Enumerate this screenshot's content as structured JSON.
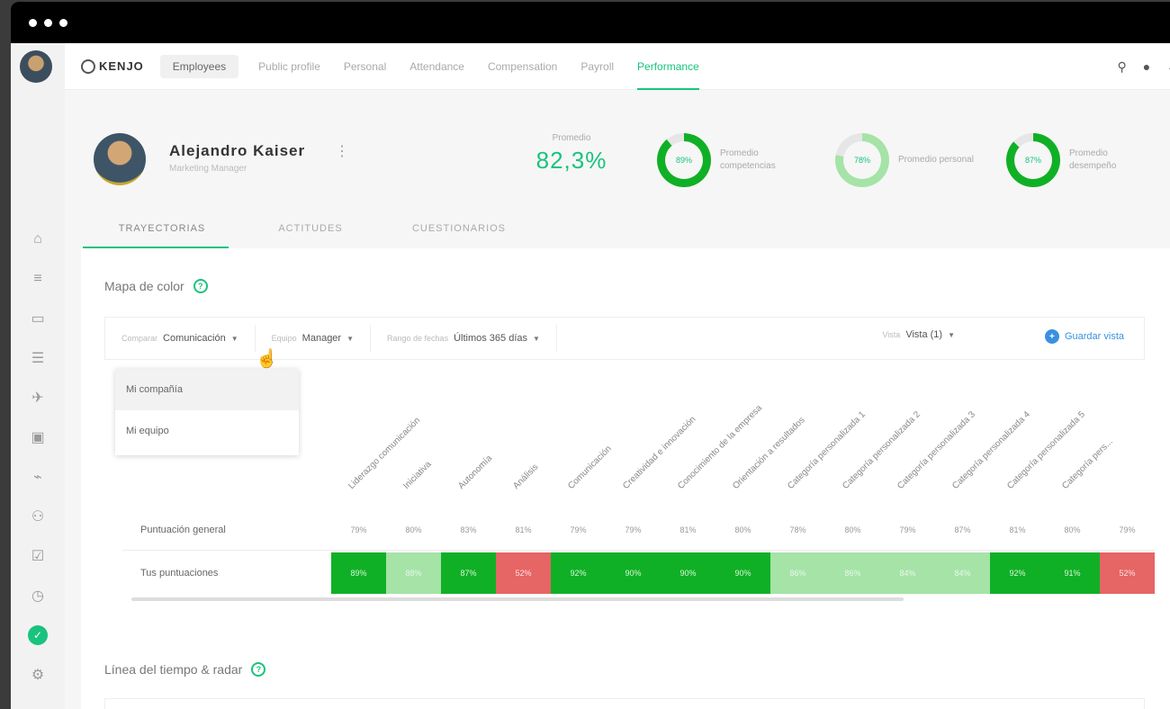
{
  "window": {
    "title_dots": 3
  },
  "topnav": {
    "logo": "KENJO",
    "pill": "Employees",
    "tabs": [
      "Public profile",
      "Personal",
      "Attendance",
      "Compensation",
      "Payroll",
      "Performance"
    ],
    "active_tab": "Performance"
  },
  "profile": {
    "name": "Alejandro Kaiser",
    "role": "Marketing Manager",
    "average_label": "Promedio",
    "average_value": "82,3%",
    "rings": [
      {
        "value": "89%",
        "fraction": 0.89,
        "label": "Promedio competencias",
        "style": "dark"
      },
      {
        "value": "78%",
        "fraction": 0.78,
        "label": "Promedio personal",
        "style": "light"
      },
      {
        "value": "87%",
        "fraction": 0.87,
        "label": "Promedio desempeño",
        "style": "dark"
      }
    ]
  },
  "sub_tabs": [
    "TRAYECTORIAS",
    "ACTITUDES",
    "CUESTIONARIOS"
  ],
  "heatmap_section": {
    "title": "Mapa de color",
    "help": "?",
    "filters": [
      {
        "label": "Comparar",
        "value": "Comunicación"
      },
      {
        "label": "Equipo",
        "value": "Manager"
      },
      {
        "label": "Rango de fechas",
        "value": "Últimos 365 días"
      }
    ],
    "view_filter": {
      "label": "Vista",
      "value": "Vista (1)"
    },
    "add_button": "Guardar vista",
    "dropdown_items": [
      "Mi compañía",
      "Mi equipo"
    ],
    "columns": [
      "Liderazgo comunicación",
      "Iniciativa",
      "Autonomía",
      "Análisis",
      "Comunicación",
      "Creatividad e innovación",
      "Conocimiento de la empresa",
      "Orientación a resultados",
      "Categoría personalizada 1",
      "Categoría personalizada 2",
      "Categoría personalizada 3",
      "Categoría personalizada 4",
      "Categoría personalizada 5",
      "Categoría pers..."
    ],
    "rows": [
      {
        "label": "Puntuación general",
        "cells": [
          "79%",
          "80%",
          "83%",
          "81%",
          "79%",
          "79%",
          "81%",
          "80%",
          "78%",
          "80%",
          "79%",
          "87%",
          "81%",
          "80%",
          "79%"
        ]
      },
      {
        "label": "Tus puntuaciones",
        "cells": [
          "89%",
          "88%",
          "87%",
          "52%",
          "92%",
          "90%",
          "90%",
          "90%",
          "86%",
          "86%",
          "84%",
          "84%",
          "92%",
          "91%",
          "52%"
        ],
        "styles": [
          "green",
          "light",
          "green",
          "red",
          "green",
          "green",
          "green",
          "green",
          "light",
          "light",
          "light",
          "light",
          "green",
          "green",
          "red"
        ]
      }
    ]
  },
  "timeline_section": {
    "title": "Línea del tiempo & radar",
    "help": "?"
  },
  "colors": {
    "accent": "#19c37d",
    "cell_green": "#10b026",
    "cell_light": "#a5e3a7",
    "cell_red": "#e66565",
    "link_blue": "#3a90e0"
  },
  "icons": {
    "rail": [
      "home-icon",
      "list-icon",
      "briefcase-icon",
      "document-icon",
      "plane-icon",
      "calendar-icon",
      "chart-icon",
      "people-icon",
      "checklist-icon",
      "clock-icon",
      "performance-icon",
      "settings-icon"
    ],
    "top": [
      "search-icon",
      "bell-icon",
      "chevron-down-icon"
    ]
  }
}
